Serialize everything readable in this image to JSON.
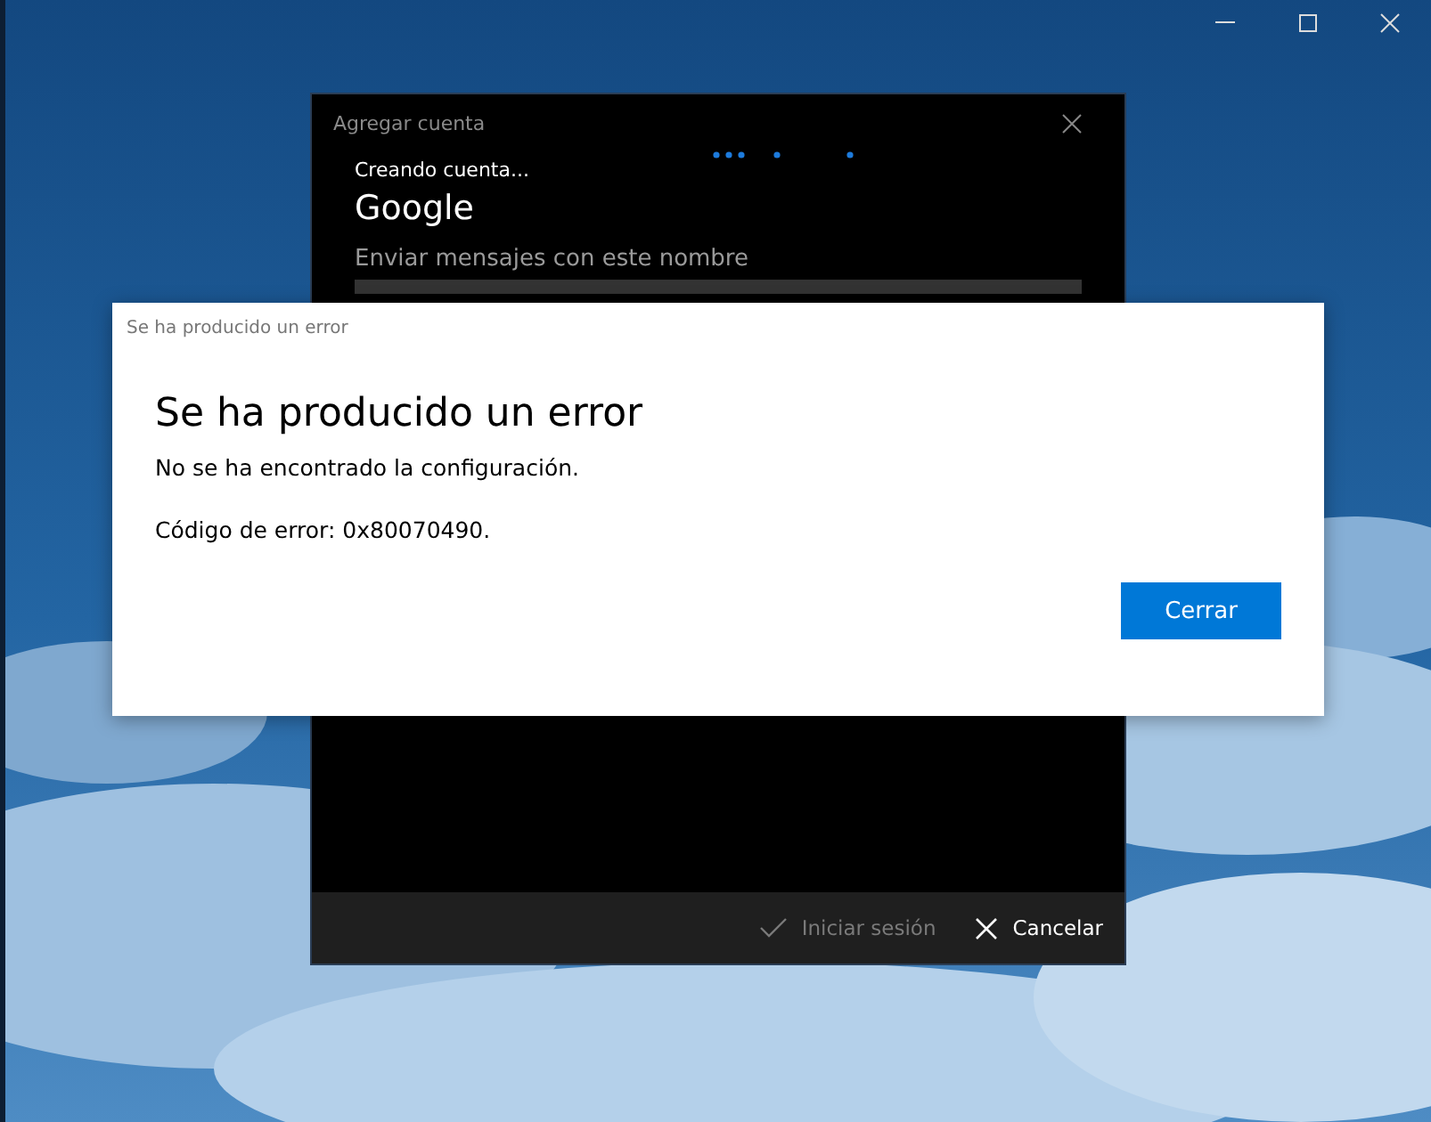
{
  "account_dialog": {
    "title": "Agregar cuenta",
    "status": "Creando cuenta...",
    "provider": "Google",
    "field_label": "Enviar mensajes con este nombre",
    "buttons": [
      {
        "label": "Iniciar sesión",
        "kind": "confirm",
        "disabled": true
      },
      {
        "label": "Cancelar",
        "kind": "cancel",
        "disabled": false
      }
    ]
  },
  "error_dialog": {
    "title": "Se ha producido un error",
    "heading": "Se ha producido un error",
    "message": "No se ha encontrado la configuración.",
    "code": "Código de error: 0x80070490.",
    "button": "Cerrar"
  }
}
